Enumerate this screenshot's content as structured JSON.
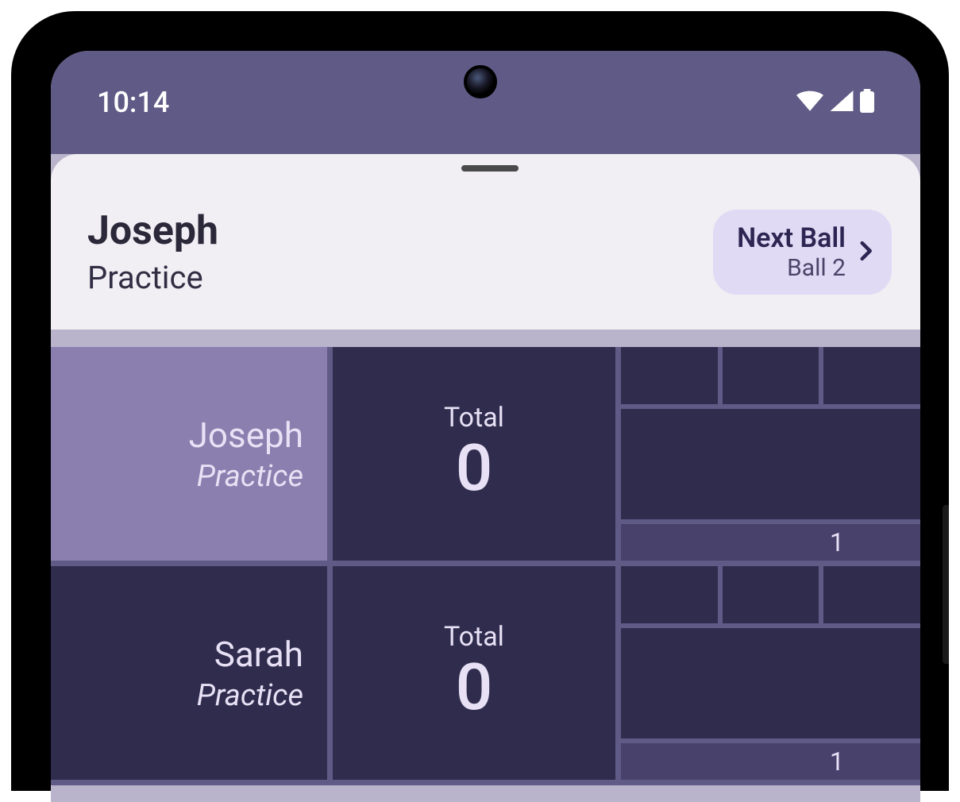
{
  "statusbar": {
    "time": "10:14"
  },
  "header": {
    "title": "Joseph",
    "subtitle": "Practice",
    "next_ball": {
      "label": "Next Ball",
      "detail": "Ball 2"
    }
  },
  "players": [
    {
      "name": "Joseph",
      "mode": "Practice",
      "active": true,
      "total_label": "Total",
      "total_value": "0",
      "frame_number": "1"
    },
    {
      "name": "Sarah",
      "mode": "Practice",
      "active": false,
      "total_label": "Total",
      "total_value": "0",
      "frame_number": "1"
    }
  ]
}
